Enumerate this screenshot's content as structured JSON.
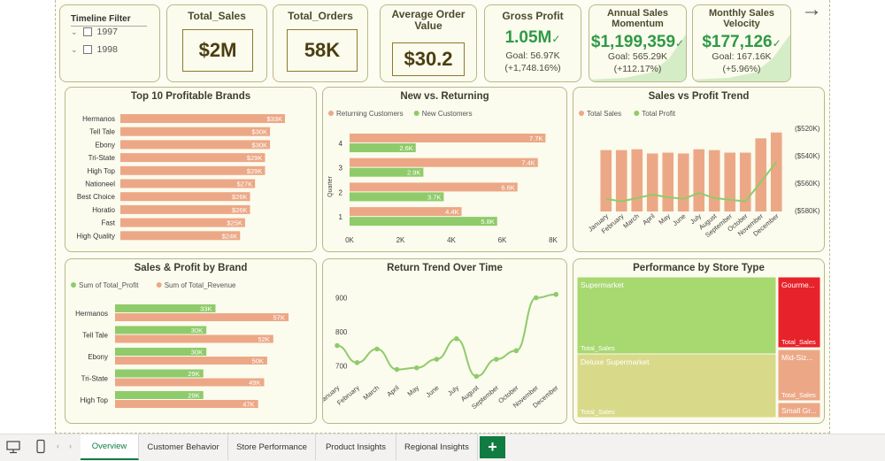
{
  "filter": {
    "title": "Timeline Filter",
    "items": [
      "1997",
      "1998"
    ]
  },
  "kpis": {
    "total_sales": {
      "title": "Total_Sales",
      "value": "$2M"
    },
    "total_orders": {
      "title": "Total_Orders",
      "value": "58K"
    },
    "aov": {
      "title": "Average Order Value",
      "value": "$30.2"
    },
    "gross_profit": {
      "title": "Gross Profit",
      "value": "1.05M",
      "goal": "Goal: 56.97K",
      "delta": "(+1,748.16%)"
    },
    "annual_momentum": {
      "title": "Annual Sales Momentum",
      "value": "$1,199,359",
      "goal": "Goal: 565.29K",
      "delta": "(+112.17%)"
    },
    "monthly_velocity": {
      "title": "Monthly Sales Velocity",
      "value": "$177,126",
      "goal": "Goal: 167.16K",
      "delta": "(+5.96%)"
    }
  },
  "colors": {
    "sales": "#eca886",
    "profit": "#8fcb6a",
    "green_text": "#2f9a45"
  },
  "panels": {
    "brands": "Top 10 Profitable Brands",
    "newret": "New vs. Returning",
    "trend": "Sales vs Profit Trend",
    "brandsp": "Sales & Profit by Brand",
    "returns": "Return Trend Over Time",
    "store": "Performance by Store Type"
  },
  "chart_data": [
    {
      "type": "bar",
      "title": "Top 10 Profitable Brands",
      "categories": [
        "Hermanos",
        "Tell Tale",
        "Ebony",
        "Tri-State",
        "High Top",
        "Nationeel",
        "Best Choice",
        "Horatio",
        "Fast",
        "High Quality"
      ],
      "values": [
        33,
        30,
        30,
        29,
        29,
        27,
        26,
        26,
        25,
        24
      ],
      "labels": [
        "$33K",
        "$30K",
        "$30K",
        "$29K",
        "$29K",
        "$27K",
        "$26K",
        "$26K",
        "$25K",
        "$24K"
      ]
    },
    {
      "type": "bar",
      "title": "New vs. Returning",
      "ylabel": "Quarter",
      "categories": [
        "4",
        "3",
        "2",
        "1"
      ],
      "series": [
        {
          "name": "Returning Customers",
          "values": [
            7.7,
            7.4,
            6.6,
            4.4
          ],
          "labels": [
            "7.7K",
            "7.4K",
            "6.6K",
            "4.4K"
          ]
        },
        {
          "name": "New Customers",
          "values": [
            2.6,
            2.9,
            3.7,
            5.8
          ],
          "labels": [
            "2.6K",
            "2.9K",
            "3.7K",
            "5.8K"
          ]
        }
      ],
      "xticks": [
        "0K",
        "2K",
        "4K",
        "6K",
        "8K"
      ],
      "xlim": [
        0,
        8
      ]
    },
    {
      "type": "bar",
      "title": "Sales vs Profit Trend",
      "categories": [
        "January",
        "February",
        "March",
        "April",
        "May",
        "June",
        "July",
        "August",
        "September",
        "October",
        "November",
        "December"
      ],
      "series": [
        {
          "name": "Total Sales",
          "values": [
            0.73,
            0.73,
            0.74,
            0.69,
            0.7,
            0.69,
            0.74,
            0.73,
            0.7,
            0.7,
            0.87,
            0.94
          ]
        },
        {
          "name": "Total Profit",
          "values": [
            0.15,
            0.12,
            0.16,
            0.2,
            0.17,
            0.15,
            0.22,
            0.16,
            0.14,
            0.12,
            0.35,
            0.59
          ]
        }
      ],
      "yticks": [
        "($520K)",
        "($540K)",
        "($560K)",
        "($580K)"
      ]
    },
    {
      "type": "bar",
      "title": "Sales & Profit by Brand",
      "categories": [
        "Hermanos",
        "Tell Tale",
        "Ebony",
        "Tri-State",
        "High Top"
      ],
      "series": [
        {
          "name": "Sum of Total_Profit",
          "values": [
            33,
            30,
            30,
            29,
            29
          ],
          "labels": [
            "33K",
            "30K",
            "30K",
            "29K",
            "29K"
          ]
        },
        {
          "name": "Sum of Total_Revenue",
          "values": [
            57,
            52,
            50,
            49,
            47
          ],
          "labels": [
            "57K",
            "52K",
            "50K",
            "49K",
            "47K"
          ]
        }
      ]
    },
    {
      "type": "line",
      "title": "Return Trend Over Time",
      "categories": [
        "January",
        "February",
        "March",
        "April",
        "May",
        "June",
        "July",
        "August",
        "September",
        "October",
        "November",
        "December"
      ],
      "values": [
        760,
        710,
        750,
        690,
        695,
        720,
        780,
        670,
        720,
        745,
        900,
        910
      ],
      "yticks": [
        900,
        800,
        700
      ],
      "ylim": [
        650,
        930
      ]
    },
    {
      "type": "table",
      "title": "Performance by Store Type",
      "cells": [
        {
          "name": "Supermarket",
          "label": "Total_Sales",
          "color": "#a8d870"
        },
        {
          "name": "Deluxe Supermarket",
          "label": "Total_Sales",
          "color": "#d8da8a"
        },
        {
          "name": "Gourme...",
          "label": "Total_Sales",
          "color": "#e8222a"
        },
        {
          "name": "Mid-Siz...",
          "label": "Total_Sales",
          "color": "#eca886"
        },
        {
          "name": "Small Gr...",
          "label": "",
          "color": "#eca886"
        }
      ]
    }
  ],
  "tabs": [
    "Overview",
    "Customer Behavior",
    "Store Performance",
    "Product Insights",
    "Regional Insights"
  ],
  "add_tab": "+"
}
